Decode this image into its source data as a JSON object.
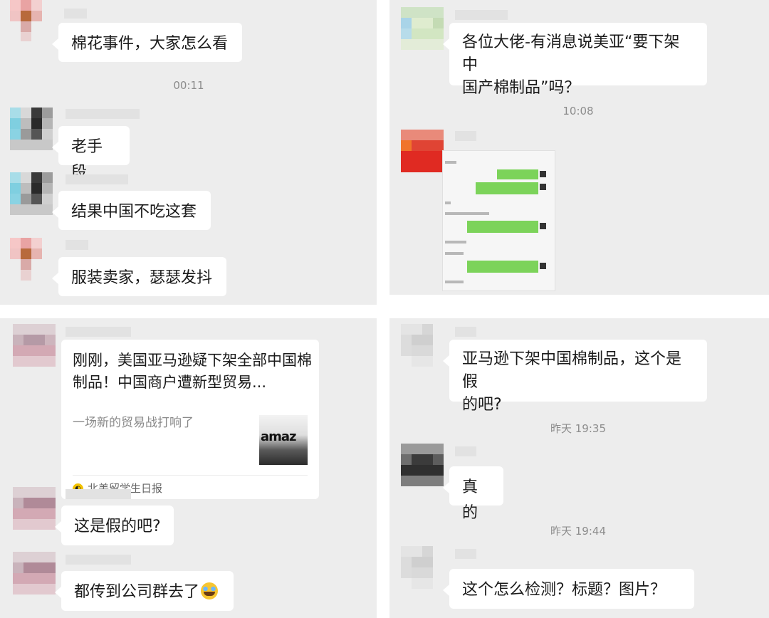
{
  "panels": {
    "top_left": {
      "messages": [
        "棉花事件，大家怎么看",
        "老手段",
        "结果中国不吃这套",
        "服装卖家，瑟瑟发抖"
      ],
      "timestamp": "00:11"
    },
    "top_right": {
      "messages": [
        "各位大佬-有消息说美亚“要下架中\n国产棉制品”吗？"
      ],
      "timestamp": "10:08"
    },
    "bottom_left": {
      "link_card": {
        "title": "刚刚，美国亚马逊疑下架全部中国棉制品！中国商户遭新型贸易...",
        "description": "一场新的贸易战打响了",
        "thumbnail_text": "amaz",
        "source": "北美留学生日报"
      },
      "messages": [
        "这是假的吧?",
        "都传到公司群去了"
      ]
    },
    "bottom_right": {
      "messages": [
        "亚马逊下架中国棉制品，这个是假\n的吧?",
        "真的",
        "这个怎么检测？标题？图片？"
      ],
      "timestamps": [
        "昨天 19:35",
        "昨天 19:44"
      ]
    }
  },
  "colors": {
    "chat_background": "#ededed",
    "bubble": "#ffffff",
    "timestamp_text": "#8c8c8c",
    "link_source_icon": "#f2c200"
  },
  "icons": {
    "laughing_emoji": "laughing-crying-emoji-icon",
    "source_badge": "source-badge-icon"
  }
}
